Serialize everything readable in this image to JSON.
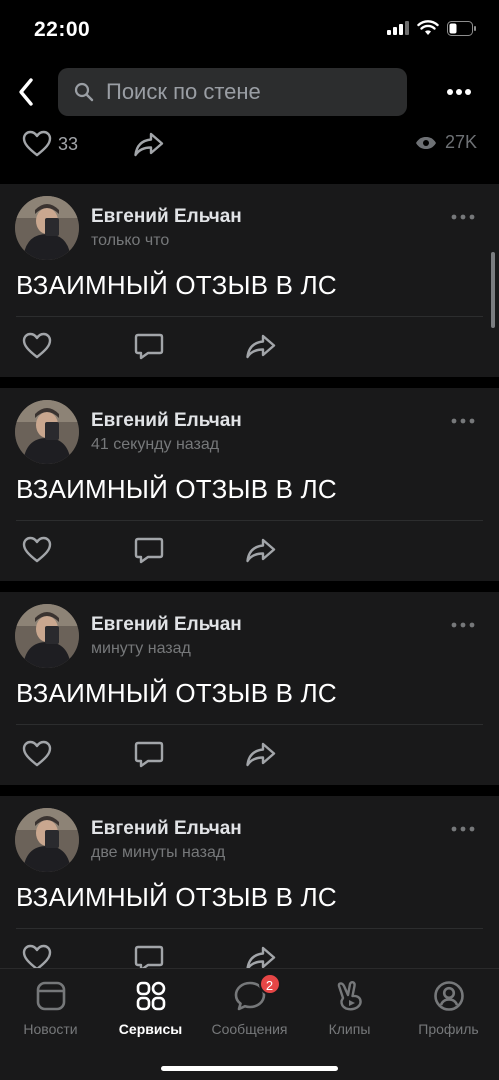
{
  "status": {
    "time": "22:00"
  },
  "search": {
    "placeholder": "Поиск по стене"
  },
  "top_post": {
    "likes": "33",
    "views": "27K"
  },
  "posts": [
    {
      "author": "Евгений Ельчан",
      "time": "только что",
      "text": "ВЗАИМНЫЙ ОТЗЫВ В ЛС"
    },
    {
      "author": "Евгений Ельчан",
      "time": "41 секунду назад",
      "text": "ВЗАИМНЫЙ ОТЗЫВ В ЛС"
    },
    {
      "author": "Евгений Ельчан",
      "time": "минуту назад",
      "text": "ВЗАИМНЫЙ ОТЗЫВ В ЛС"
    },
    {
      "author": "Евгений Ельчан",
      "time": "две минуты назад",
      "text": "ВЗАИМНЫЙ ОТЗЫВ В ЛС"
    }
  ],
  "tabs": [
    {
      "label": "Новости",
      "icon": "news-icon",
      "active": false
    },
    {
      "label": "Сервисы",
      "icon": "services-icon",
      "active": true
    },
    {
      "label": "Сообщения",
      "icon": "messages-icon",
      "active": false,
      "badge": "2"
    },
    {
      "label": "Клипы",
      "icon": "clips-icon",
      "active": false
    },
    {
      "label": "Профиль",
      "icon": "profile-icon",
      "active": false
    }
  ],
  "colors": {
    "background": "#000000",
    "card": "#19191a",
    "badge": "#e64646",
    "muted": "#76787a"
  }
}
